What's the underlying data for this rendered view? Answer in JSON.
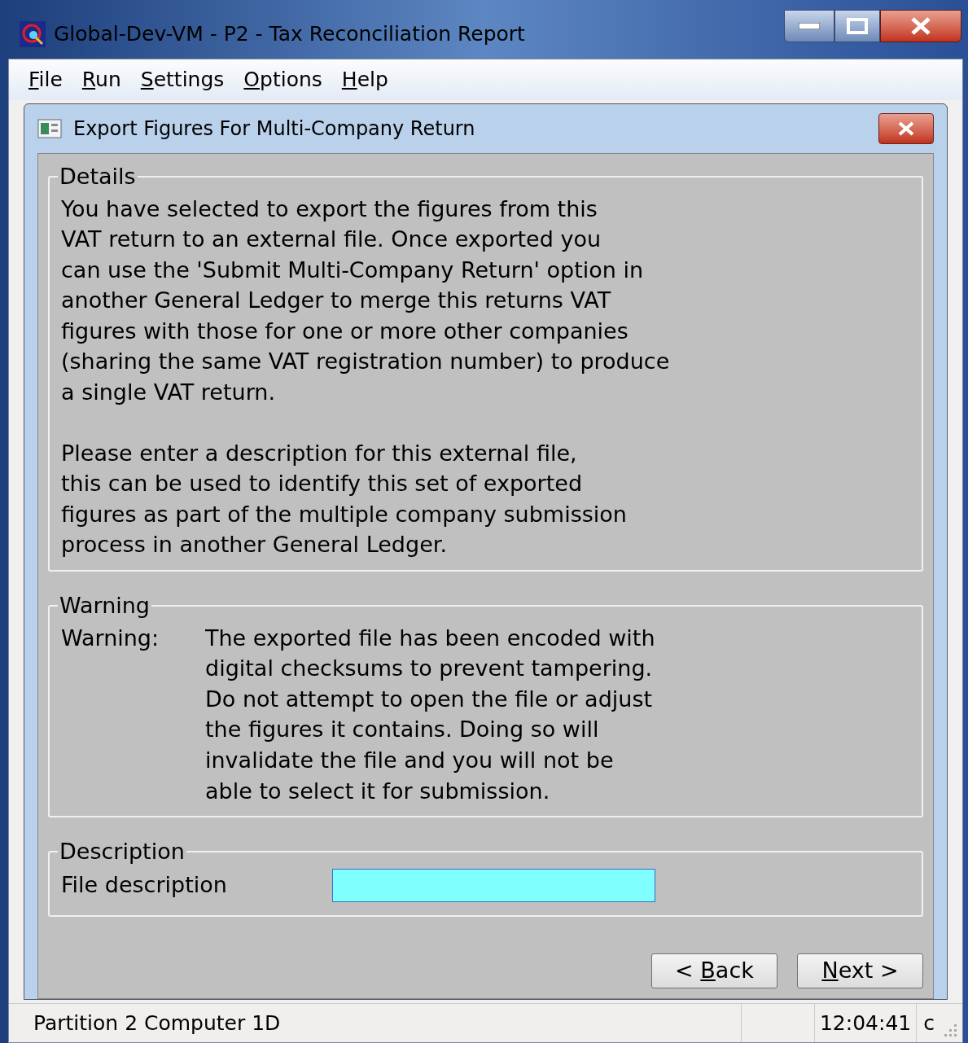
{
  "window": {
    "title": "Global-Dev-VM - P2 - Tax Reconciliation Report"
  },
  "menu": [
    {
      "key": "F",
      "rest": "ile"
    },
    {
      "key": "R",
      "rest": "un"
    },
    {
      "key": "S",
      "rest": "ettings"
    },
    {
      "key": "O",
      "rest": "ptions"
    },
    {
      "key": "H",
      "rest": "elp"
    }
  ],
  "dialog": {
    "title": "Export Figures For Multi-Company Return",
    "details": {
      "legend": "Details",
      "paragraphs": [
        [
          "You have selected to export the figures from this",
          "VAT return to an external file. Once exported you",
          "can use the 'Submit Multi-Company Return' option in",
          "another General Ledger to merge this returns VAT",
          "figures with those for one or more other companies",
          "(sharing the same VAT registration number) to produce",
          "a single VAT return."
        ],
        [
          "Please enter a description for this external file,",
          "this can be used to identify this set of exported",
          "figures as part of the multiple company submission",
          "process in another General Ledger."
        ]
      ]
    },
    "warning": {
      "legend": "Warning",
      "label": "Warning:",
      "lines": [
        "The exported file has been encoded with",
        "digital checksums to prevent tampering.",
        "Do not attempt to open the file or adjust",
        "the figures it contains.  Doing so will",
        "invalidate the file and you will not be",
        "able to select it for submission."
      ]
    },
    "description": {
      "legend": "Description",
      "label": "File description"
    },
    "buttons": [
      {
        "pre": "< ",
        "key": "B",
        "rest": "ack"
      },
      {
        "key": "N",
        "rest": "ext >"
      }
    ]
  },
  "status_bar": {
    "text": "Partition 2 Computer 1D",
    "time": "12:04:41",
    "mode": "c"
  }
}
